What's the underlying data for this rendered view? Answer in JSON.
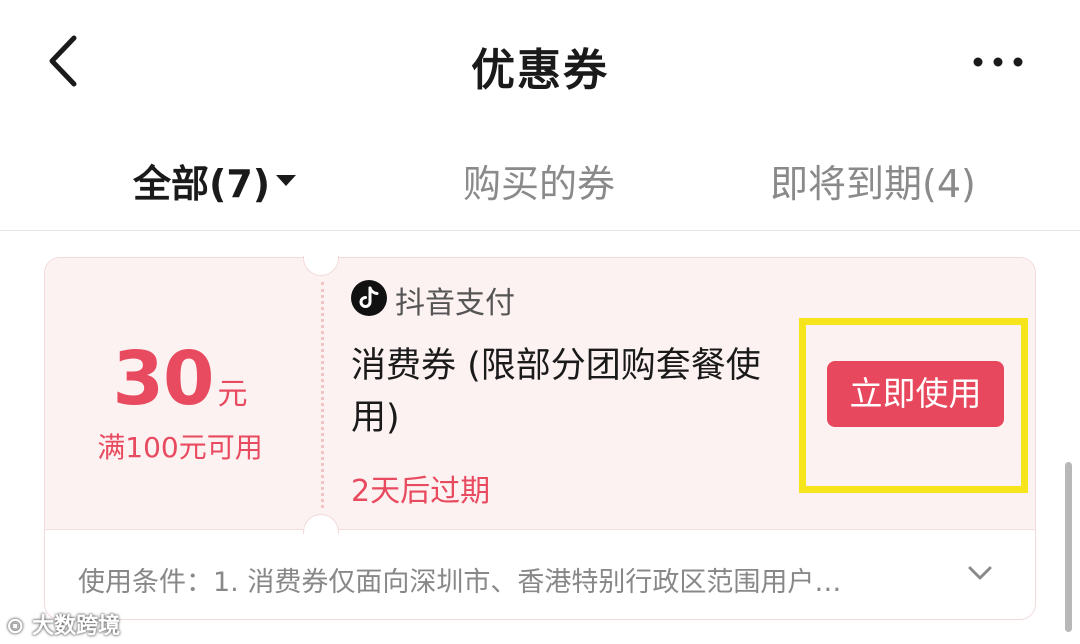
{
  "header": {
    "title": "优惠券"
  },
  "tabs": [
    {
      "label": "全部(7)"
    },
    {
      "label": "购买的券"
    },
    {
      "label": "即将到期(4)"
    }
  ],
  "coupon": {
    "amount": "30",
    "unit": "元",
    "threshold": "满100元可用",
    "brand": "抖音支付",
    "title": "消费券 (限部分团购套餐使用)",
    "expiry": "2天后过期",
    "action_label": "立即使用",
    "conditions": "使用条件：1. 消费券仅面向深圳市、香港特别行政区范围用户…"
  },
  "watermark": {
    "text": "大数跨境"
  },
  "colors": {
    "accent": "#e8485d",
    "coupon_bg": "#fdf2f2",
    "highlight": "#f6e51c"
  }
}
